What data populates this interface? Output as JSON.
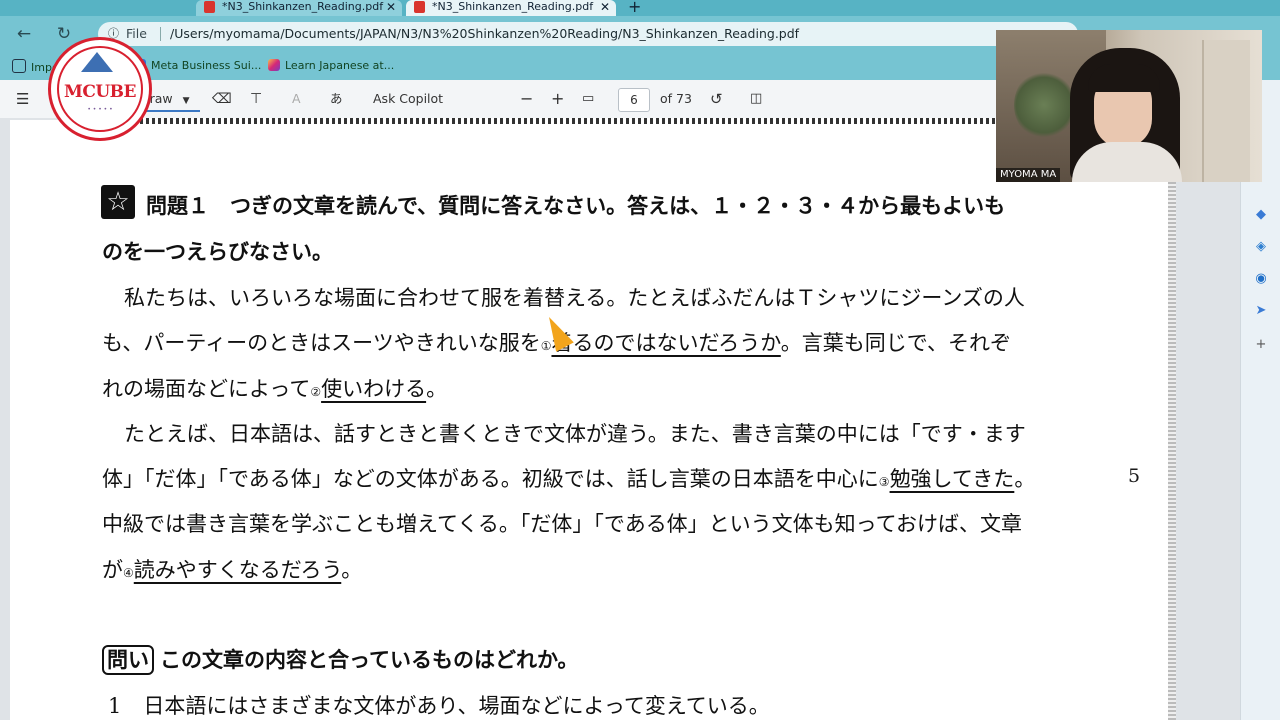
{
  "browser": {
    "tabs": [
      {
        "label": "*N3_Shinkanzen_Reading.pdf"
      },
      {
        "label": "*N3_Shinkanzen_Reading.pdf"
      }
    ],
    "address": {
      "label": "File",
      "url": "/Users/myomama/Documents/JAPAN/N3/N3%20Shinkanzen%20Reading/N3_Shinkanzen_Reading.pdf"
    },
    "bookmarks": [
      {
        "label": "Import fav"
      },
      {
        "label": "Meta Business Sui..."
      },
      {
        "label": "Learn Japanese at..."
      }
    ]
  },
  "toolbar": {
    "draw_label": "Draw",
    "ask_label": "Ask Copilot",
    "page_current": "6",
    "page_total": "of 73"
  },
  "webcam": {
    "name": "MYOMA MA"
  },
  "logo": {
    "text": "MCUBE"
  },
  "document": {
    "q_title": "問題１　つぎの文章を読んで、質問に答えなさい。答えは、１・２・３・４から最もよいも",
    "q_title2": "のを一つえらびなさい。",
    "p1_a": "私たちは、いろいろな場面に合わせて服を着替える。たとえばふだんはＴシャツにジーンズの人",
    "p1_b1": "も、パーティーのときはスーツやきれいな服を",
    "p1_b_mark": "①",
    "p1_b_ul": "着るのではないだろうか",
    "p1_b2": "。言葉も同じで、それぞ",
    "p1_c1": "れの場面などによって",
    "p1_c_mark": "②",
    "p1_c_ul": "使いわける",
    "p1_c2": "。",
    "p2_a": "たとえば、日本語は、話すときと書くときで文体が違う。また、書き言葉の中には「です・ます",
    "p2_b1": "体」「だ体」「である体」などの文体がある。初級では、話し言葉の日本語を中心に",
    "p2_b_mark": "③",
    "p2_b_ul": "勉強してきた",
    "p2_b2": "。",
    "line_number": "5",
    "p2_c": "中級では書き言葉を学ぶことも増えてくる。「だ体」「である体」という文体も知っておけば、文章",
    "p2_d1": "が",
    "p2_d_mark": "④",
    "p2_d_ul": "読みやすくなるだろう",
    "p2_d2": "。",
    "toi_label": "問い",
    "toi_question": "この文章の内容と合っているものはどれか。",
    "opt1_num": "1",
    "opt1_text": "日本語にはさまざまな文体があり、場面などによって変えている。"
  }
}
